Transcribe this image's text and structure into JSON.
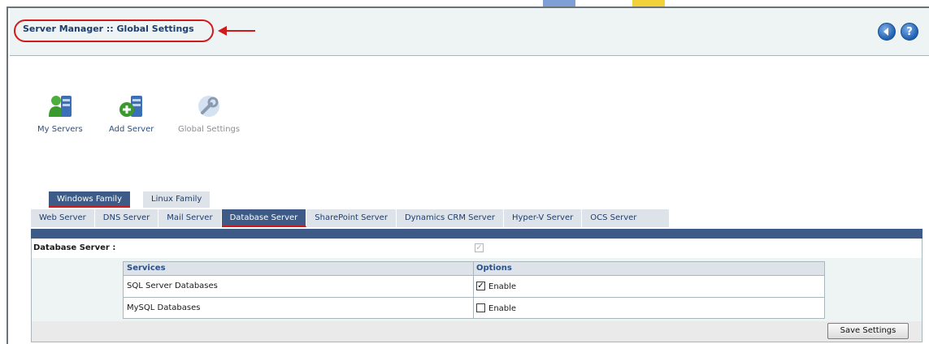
{
  "header": {
    "title": "Server Manager :: Global Settings",
    "back_icon": "back-arrow-icon",
    "help_icon": "help-icon",
    "help_glyph": "?"
  },
  "toolbar": {
    "items": [
      {
        "label": "My Servers",
        "icon": "servers-user-icon"
      },
      {
        "label": "Add Server",
        "icon": "add-server-icon"
      },
      {
        "label": "Global Settings",
        "icon": "global-settings-icon"
      }
    ]
  },
  "family_tabs": [
    {
      "label": "Windows Family",
      "active": true
    },
    {
      "label": "Linux Family",
      "active": false
    }
  ],
  "server_tabs": [
    {
      "label": "Web Server",
      "active": false
    },
    {
      "label": "DNS Server",
      "active": false
    },
    {
      "label": "Mail Server",
      "active": false
    },
    {
      "label": "Database Server",
      "active": true
    },
    {
      "label": "SharePoint Server",
      "active": false
    },
    {
      "label": "Dynamics CRM Server",
      "active": false
    },
    {
      "label": "Hyper-V Server",
      "active": false
    },
    {
      "label": "OCS Server",
      "active": false
    }
  ],
  "panel": {
    "db_label": "Database Server :",
    "db_checked": true,
    "table": {
      "headers": {
        "services": "Services",
        "options": "Options"
      },
      "rows": [
        {
          "service": "SQL Server Databases",
          "option": "Enable",
          "checked": true
        },
        {
          "service": "MySQL Databases",
          "option": "Enable",
          "checked": false
        }
      ]
    },
    "save_label": "Save Settings"
  },
  "colors": {
    "accent": "#3d5b86",
    "highlight": "#d11a1a",
    "header_bg": "#eef3f3"
  }
}
